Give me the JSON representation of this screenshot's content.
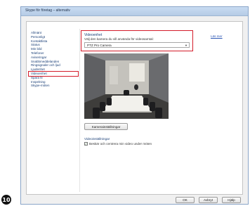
{
  "step_number": "10",
  "window": {
    "title": "Skype för företag – alternativ"
  },
  "nav": {
    "items": [
      {
        "label": "Allmänt",
        "selected": false
      },
      {
        "label": "Personligt",
        "selected": false
      },
      {
        "label": "Kontaktlista",
        "selected": false
      },
      {
        "label": "Status",
        "selected": false
      },
      {
        "label": "Min bild",
        "selected": false
      },
      {
        "label": "Telefoner",
        "selected": false
      },
      {
        "label": "Aviseringar",
        "selected": false
      },
      {
        "label": "Snabbmeddelanden",
        "selected": false
      },
      {
        "label": "Ringsignaler och ljud",
        "selected": false
      },
      {
        "label": "Ljudenhet",
        "selected": false
      },
      {
        "label": "Videoenhet",
        "selected": true
      },
      {
        "label": "Spara fil",
        "selected": false
      },
      {
        "label": "Inspelning",
        "selected": false
      },
      {
        "label": "Skype-möten",
        "selected": false
      }
    ]
  },
  "video_device": {
    "heading": "Videoenhet",
    "description": "Välj den kamera du vill använda för videosamtal:",
    "selected_camera": "PTZ Pro Camera"
  },
  "help_link": "Läs mer",
  "camera_settings_button": "Kamerainställningar",
  "video_settings": {
    "heading": "Videoinställningar",
    "crop_label": "Beskär och centrera min video under möten",
    "crop_checked": true
  },
  "footer": {
    "ok_label": "OK",
    "cancel_label": "Avbryt",
    "help_label": "Hjälp"
  },
  "colors": {
    "highlight": "#d41c2a",
    "link": "#2a55b4",
    "label": "#1a3f77"
  }
}
